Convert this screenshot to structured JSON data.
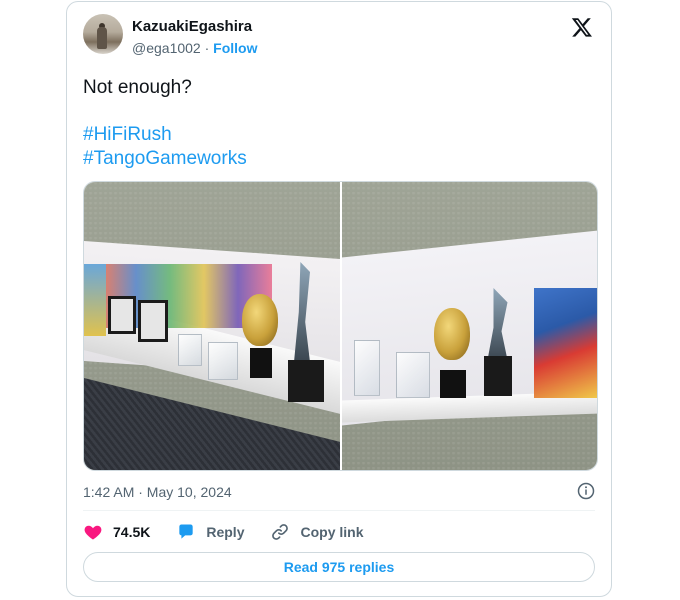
{
  "author": {
    "display_name": "KazuakiEgashira",
    "handle": "@ega1002",
    "separator": "·",
    "follow_label": "Follow"
  },
  "tweet": {
    "text": "Not enough?",
    "hashtags": [
      "#HiFiRush",
      "#TangoGameworks"
    ],
    "timestamp": "1:42 AM · May 10, 2024"
  },
  "media": {
    "images": [
      {
        "alt": "Award shelf left"
      },
      {
        "alt": "Award shelf right"
      }
    ]
  },
  "actions": {
    "likes": "74.5K",
    "reply_label": "Reply",
    "copy_label": "Copy link"
  },
  "footer": {
    "read_replies_label": "Read 975 replies"
  },
  "icons": {
    "logo": "x-logo-icon",
    "info": "info-icon",
    "like": "heart-icon",
    "reply": "speech-bubble-icon",
    "copy": "link-icon"
  },
  "colors": {
    "accent": "#1d9bf0",
    "like": "#f91880",
    "text": "#0f1419",
    "secondary": "#536471",
    "border": "#cfd9de"
  }
}
